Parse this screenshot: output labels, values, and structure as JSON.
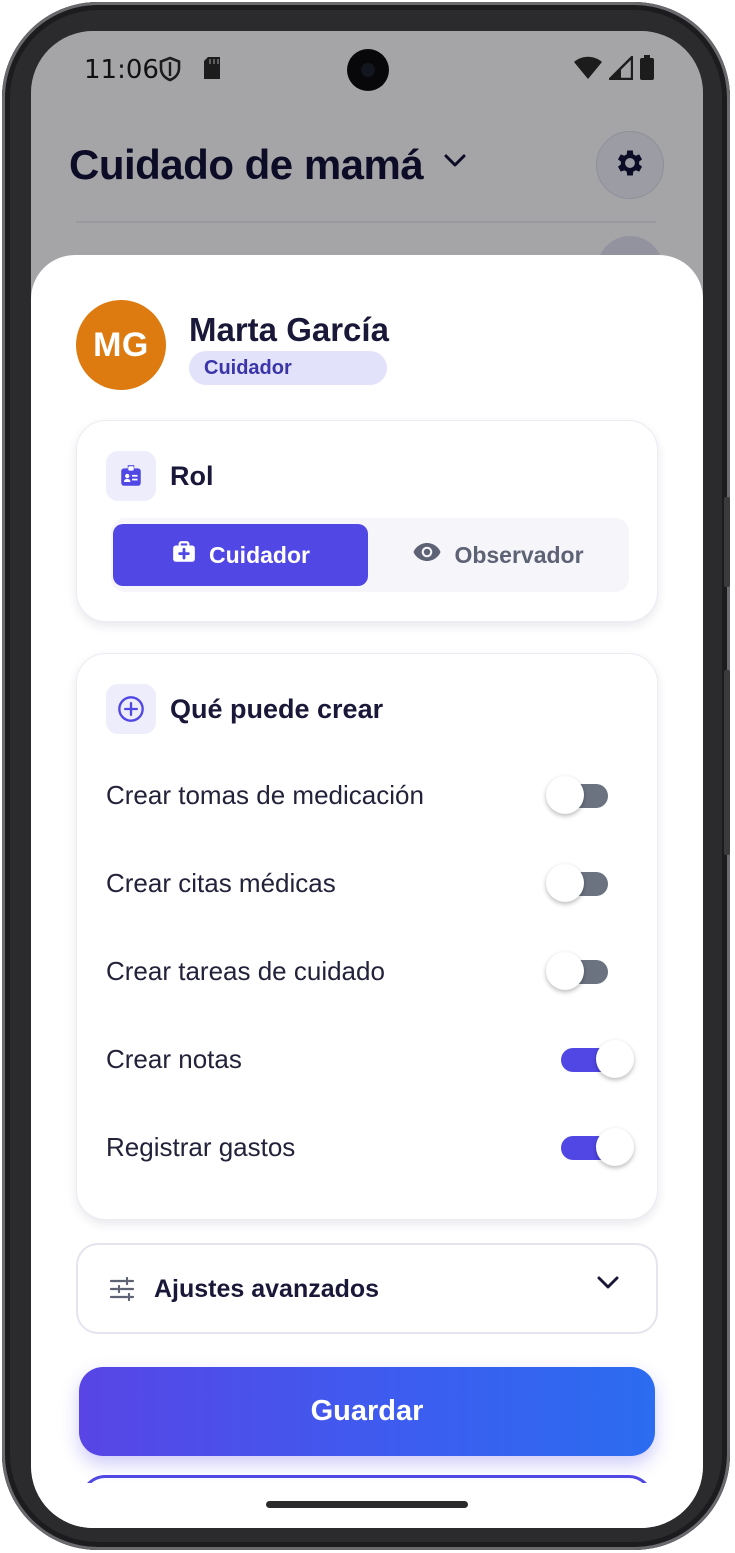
{
  "status_bar": {
    "time": "11:06",
    "icons": [
      "shield-icon",
      "sd-card-icon",
      "wifi-icon",
      "signal-icon",
      "battery-icon"
    ]
  },
  "app": {
    "title": "Cuidado de mamá",
    "settings_icon": "gear-icon"
  },
  "sheet": {
    "avatar_initials": "MG",
    "avatar_color": "#dd7a10",
    "user_name": "Marta García",
    "role_badge": "Cuidador",
    "role_card": {
      "title": "Rol",
      "icon": "id-badge-icon",
      "options": [
        {
          "label": "Cuidador",
          "icon": "medical-bag-icon",
          "selected": true
        },
        {
          "label": "Observador",
          "icon": "eye-icon",
          "selected": false
        }
      ]
    },
    "permissions_card": {
      "title": "Qué puede crear",
      "icon": "plus-circle-icon",
      "items": [
        {
          "label": "Crear tomas de medicación",
          "enabled": false
        },
        {
          "label": "Crear citas médicas",
          "enabled": false
        },
        {
          "label": "Crear tareas de cuidado",
          "enabled": false
        },
        {
          "label": "Crear notas",
          "enabled": true
        },
        {
          "label": "Registrar gastos",
          "enabled": true
        }
      ]
    },
    "advanced": {
      "label": "Ajustes avanzados",
      "icon": "sliders-icon"
    },
    "save_label": "Guardar"
  },
  "colors": {
    "accent": "#5147e4",
    "title_text": "#1a1838",
    "toggle_off": "#6b7280"
  }
}
